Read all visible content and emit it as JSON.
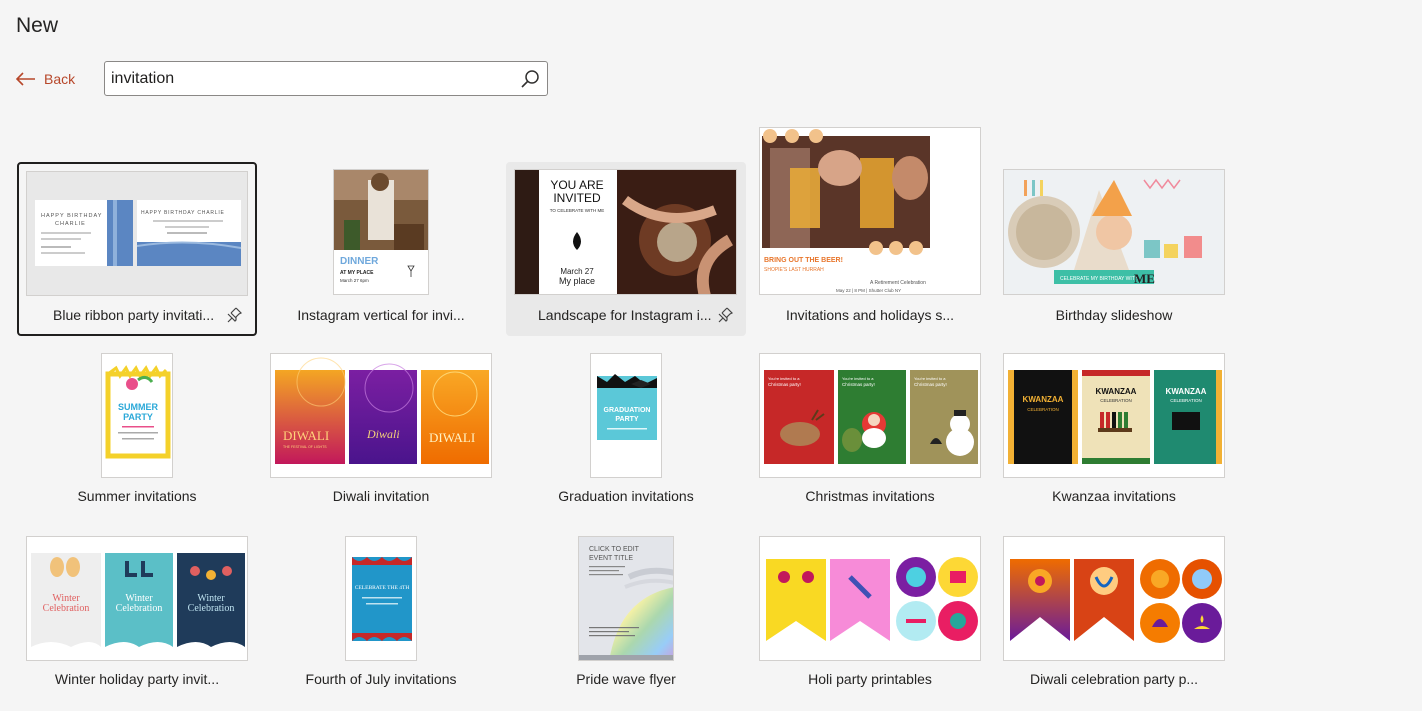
{
  "header": {
    "title": "New",
    "back_label": "Back"
  },
  "search": {
    "value": "invitation"
  },
  "templates": [
    {
      "label": "Blue ribbon party invitati...",
      "thumb": {
        "left_title": "HAPPY BIRTHDAY",
        "left_name": "CHARLIE",
        "right_title": "HAPPY BIRTHDAY CHARLIE"
      }
    },
    {
      "label": "Instagram vertical for invi...",
      "thumb": {
        "line1": "DINNER",
        "line2": "AT MY PLACE",
        "line3": "March 27 6pm"
      }
    },
    {
      "label": "Landscape for Instagram i...",
      "thumb": {
        "line1": "YOU ARE",
        "line2": "INVITED",
        "line3": "TO CELEBRATE WITH ME",
        "line4": "March 27",
        "line5": "My place"
      }
    },
    {
      "label": "Invitations and holidays s...",
      "thumb": {
        "line1": "BRING OUT THE BEER!",
        "line2": "SHOPIE'S LAST HURRAH",
        "line3": "A Retirement Celebration",
        "line4": "May 22 | 8 PM | Shutter Club NY"
      }
    },
    {
      "label": "Birthday slideshow",
      "thumb": {
        "line1": "CELEBRATE MY BIRTHDAY WITH",
        "line2": "ME"
      }
    },
    {
      "label": "Summer invitations",
      "thumb": {
        "line1": "SUMMER",
        "line2": "PARTY"
      }
    },
    {
      "label": "Diwali invitation",
      "thumb": {
        "word": "DIWALI",
        "sub": "THE FESTIVAL OF LIGHTS",
        "word2": "Diwali"
      }
    },
    {
      "label": "Graduation invitations",
      "thumb": {
        "line1": "GRADUATION",
        "line2": "PARTY"
      }
    },
    {
      "label": "Christmas invitations",
      "thumb": {
        "line1": "You're invited to a",
        "line2": "Christmas party!"
      }
    },
    {
      "label": "Kwanzaa invitations",
      "thumb": {
        "line1": "KWANZAA",
        "line2": "CELEBRATION"
      }
    },
    {
      "label": "Winter holiday party invit...",
      "thumb": {
        "line1": "Winter",
        "line2": "Celebration"
      }
    },
    {
      "label": "Fourth of July invitations",
      "thumb": {
        "line1": "CELEBRATE THE 4TH"
      }
    },
    {
      "label": "Pride wave flyer",
      "thumb": {
        "line1": "CLICK TO EDIT",
        "line2": "EVENT TITLE"
      }
    },
    {
      "label": "Holi party printables",
      "thumb": {}
    },
    {
      "label": "Diwali celebration party p...",
      "thumb": {}
    }
  ],
  "colors": {
    "accent": "#b7472a",
    "selected_border": "#201f1e"
  }
}
